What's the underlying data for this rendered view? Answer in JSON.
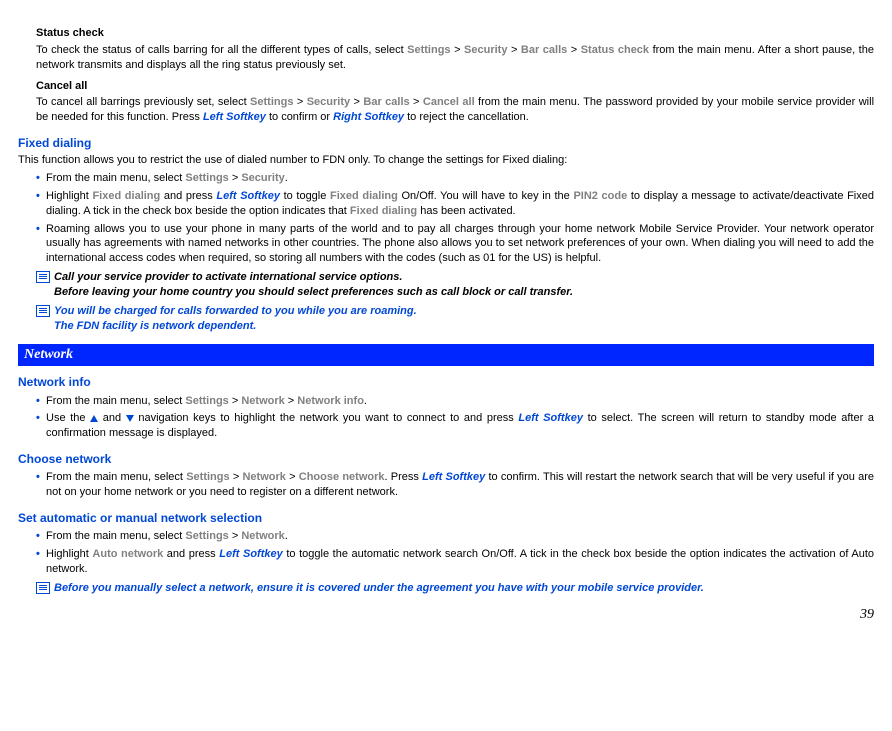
{
  "statusCheck": {
    "title": "Status check",
    "text1a": "To check the status of calls barring for all the different types of calls, select ",
    "settings": "Settings",
    "sep": " > ",
    "security": "Security",
    "barCalls": "Bar calls",
    "statusCheckLabel": "Status check",
    "text1b": " from the main menu. After a short pause, the network transmits and displays all the ring status previously set."
  },
  "cancelAll": {
    "title": "Cancel all",
    "text1a": "To cancel all barrings previously set, select ",
    "settings": "Settings",
    "security": "Security",
    "barCalls": "Bar calls",
    "cancelAllLabel": "Cancel all",
    "text1b": " from the main menu. The password provided by your mobile service provider will be needed for this function. Press ",
    "leftSoftkey": "Left Softkey",
    "text1c": " to confirm or ",
    "rightSoftkey": "Right Softkey",
    "text1d": " to reject the cancellation."
  },
  "fixedDialing": {
    "heading": "Fixed dialing",
    "intro": "This function allows you to restrict the use of dialed number to FDN only. To change the settings for Fixed dialing:",
    "b1a": "From the main menu, select ",
    "settings": "Settings",
    "security": "Security",
    "b1b": ".",
    "b2a": "Highlight ",
    "fixedDialing": "Fixed dialing",
    "b2b": " and press ",
    "leftSoftkey": "Left Softkey",
    "b2c": " to toggle ",
    "b2d": " On/Off. You will have to key in the ",
    "pin2": "PIN2 code",
    "b2e": " to display a message to activate/deactivate Fixed dialing. A tick in the check box beside the option indicates that ",
    "b2f": " has been activated.",
    "b3": "Roaming allows you to use your phone in many parts of the world and to pay all charges through your home network Mobile Service Provider. Your network operator usually has agreements with named networks in other countries. The phone also allows you to set network preferences of your own. When dialing you will need to add the international access codes when required, so storing all numbers with the codes (such as 01 for the US) is helpful.",
    "note1a": "Call your service provider to activate international service options.",
    "note1b": "Before leaving your home country you should select preferences such as call block or call transfer.",
    "note2a": "You will be charged for calls forwarded to you while you are roaming.",
    "note2b": "The FDN facility is network dependent."
  },
  "networkBar": "Network",
  "networkInfo": {
    "heading": "Network info",
    "b1a": "From the main menu, select ",
    "settings": "Settings",
    "network": "Network",
    "networkInfoLabel": "Network info",
    "b1b": ".",
    "b2a": "Use the ",
    "b2b": " and ",
    "b2c": " navigation keys to highlight the network you want to connect to and press ",
    "leftSoftkey": "Left Softkey",
    "b2d": " to select. The screen will return to standby mode after a confirmation message is displayed."
  },
  "chooseNetwork": {
    "heading": "Choose network",
    "b1a": "From the main menu, select ",
    "settings": "Settings",
    "network": "Network",
    "chooseNetworkLabel": "Choose network",
    "b1b": ". Press ",
    "leftSoftkey": "Left Softkey",
    "b1c": " to confirm. This will restart the network search that will be very useful if you are not on your home network or you need to register on a different network."
  },
  "autoManual": {
    "heading": "Set automatic or manual network selection",
    "b1a": "From the main menu, select ",
    "settings": "Settings",
    "network": "Network",
    "b1b": ".",
    "b2a": "Highlight ",
    "autoNetwork": "Auto network",
    "b2b": " and press ",
    "leftSoftkey": "Left Softkey",
    "b2c": " to toggle the automatic network search On/Off. A tick in the check box beside the option indicates the activation of Auto network.",
    "note": "Before you manually select a network, ensure it is covered under the agreement you have with your mobile service provider."
  },
  "pageNumber": "39"
}
